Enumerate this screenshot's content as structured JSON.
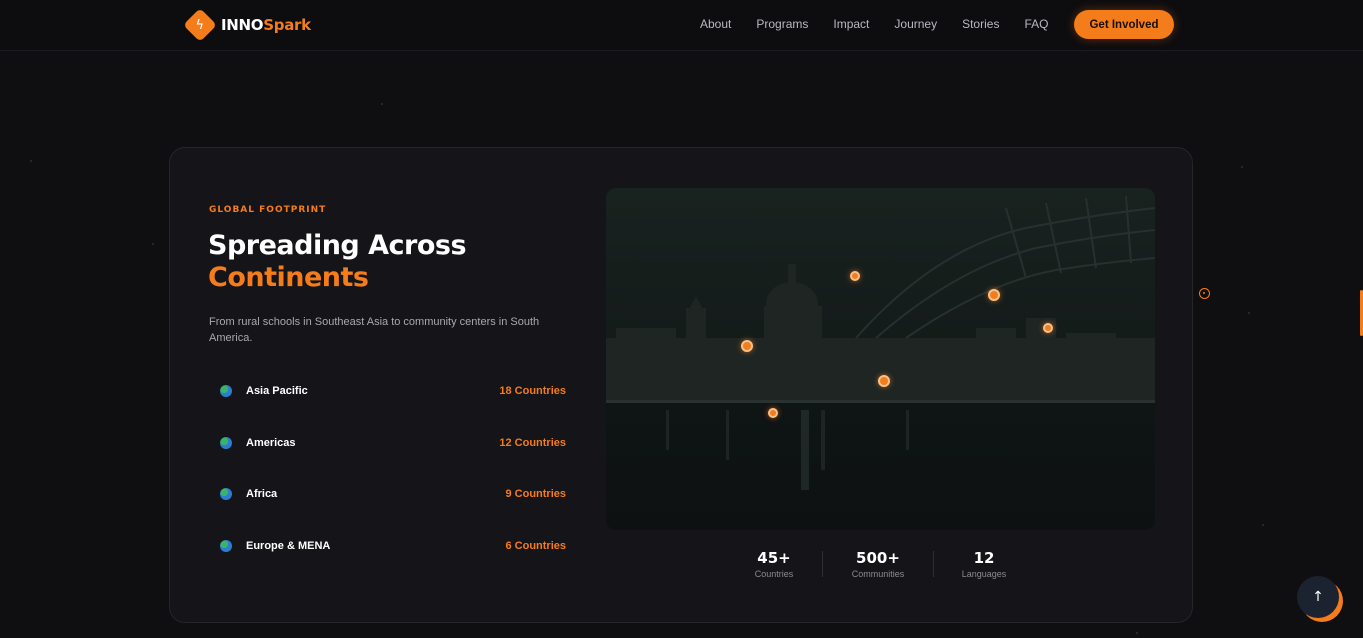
{
  "scroll_progress": 0.49,
  "brand": {
    "name_part1": "INNO",
    "name_part2": "Spark",
    "icon": "bolt-icon",
    "accent_color": "#f47c1b"
  },
  "nav": {
    "links": [
      "About",
      "Programs",
      "Impact",
      "Journey",
      "Stories",
      "FAQ"
    ],
    "cta": "Get Involved"
  },
  "section": {
    "eyebrow": "GLOBAL FOOTPRINT",
    "title_line1": "Spreading Across",
    "title_line2": "Continents",
    "description": "From rural schools in Southeast Asia to community centers in South America.",
    "regions": [
      {
        "name": "Asia Pacific",
        "count": "18 Countries",
        "icon": "globe-icon"
      },
      {
        "name": "Americas",
        "count": "12 Countries",
        "icon": "globe-icon"
      },
      {
        "name": "Africa",
        "count": "9 Countries",
        "icon": "globe-icon"
      },
      {
        "name": "Europe & MENA",
        "count": "6 Countries",
        "icon": "globe-icon"
      }
    ],
    "stats": [
      {
        "value": "45+",
        "label": "Countries"
      },
      {
        "value": "500+",
        "label": "Communities"
      },
      {
        "value": "12",
        "label": "Languages"
      }
    ]
  },
  "back_to_top": {
    "icon": "arrow-up-icon"
  }
}
